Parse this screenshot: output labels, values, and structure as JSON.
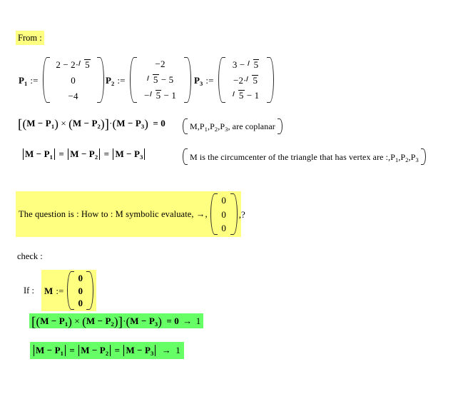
{
  "document": {
    "kind": "mathcad-worksheet",
    "colors": {
      "highlight_yellow": "#ffff80",
      "highlight_green": "#66ff66",
      "text": "#000000",
      "background": "#ffffff"
    }
  },
  "from_label": "From :",
  "definitions": [
    {
      "name": "P",
      "index": "1",
      "assign": ":=",
      "components": [
        "2 − 2·√5",
        "0",
        "−4"
      ],
      "components_parts": [
        {
          "pre": "2 − 2·",
          "radicand": "5",
          "post": ""
        },
        {
          "pre": "0",
          "radicand": "",
          "post": ""
        },
        {
          "pre": "−4",
          "radicand": "",
          "post": ""
        }
      ]
    },
    {
      "name": "P",
      "index": "2",
      "assign": ":=",
      "components": [
        "−2",
        "√5 − 5",
        "−√5 − 1"
      ],
      "components_parts": [
        {
          "pre": "−2",
          "radicand": "",
          "post": ""
        },
        {
          "pre": "",
          "radicand": "5",
          "post": " − 5"
        },
        {
          "pre": "−",
          "radicand": "5",
          "post": " − 1"
        }
      ]
    },
    {
      "name": "P",
      "index": "3",
      "assign": ":=",
      "components": [
        "3 − √5",
        "−2·√5",
        "√5 − 1"
      ],
      "components_parts": [
        {
          "pre": "3 − ",
          "radicand": "5",
          "post": ""
        },
        {
          "pre": "−2·",
          "radicand": "5",
          "post": ""
        },
        {
          "pre": "",
          "radicand": "5",
          "post": " − 1"
        }
      ]
    }
  ],
  "equations": {
    "coplanar": {
      "lhs_bracket_open": "[",
      "term1": {
        "open": "(",
        "text": "M − P",
        "sub": "1",
        "close": ")"
      },
      "cross": "×",
      "term2": {
        "open": "(",
        "text": "M − P",
        "sub": "2",
        "close": ")"
      },
      "lhs_bracket_close": "]",
      "dot": "·",
      "term3": {
        "open": "(",
        "text": "M − P",
        "sub": "3",
        "close": ")"
      },
      "equals": "=",
      "rhs": "0",
      "annotation": "M,P1,P2,P3, are coplanar",
      "annotation_parts": [
        "M,P",
        "1",
        ",P",
        "2",
        ",P",
        "3",
        ", are coplanar"
      ]
    },
    "equidistant": {
      "t1": {
        "text": "M − P",
        "sub": "1"
      },
      "eq1": "=",
      "t2": {
        "text": "M − P",
        "sub": "2"
      },
      "eq2": "=",
      "t3": {
        "text": "M − P",
        "sub": "3"
      },
      "annotation": "M is the circumcenter of the triangle that has vertex are :,P1,P2,P3",
      "annotation_prefix": "M is the circumcenter of the triangle that has vertex are :,P",
      "annotation_parts": [
        "M is the circumcenter of the triangle that has vertex are :,P",
        "1",
        ",P",
        "2",
        ",P",
        "3"
      ]
    }
  },
  "question": {
    "highlighted": true,
    "text": "The question is : How to : M symbolic evaluate, →,",
    "vector": [
      "0",
      "0",
      "0"
    ],
    "suffix": ",?"
  },
  "check": {
    "label": "check :",
    "if_label": "If :",
    "m_name": "M",
    "m_assign": ":=",
    "m_vector": [
      "0",
      "0",
      "0"
    ]
  },
  "results": [
    {
      "highlight": "green",
      "expression": "[(M − P1) × (M − P2)]·(M − P3) = 0 → 1",
      "equals": "=",
      "rhs": "0",
      "arrow": "→",
      "value": "1"
    },
    {
      "highlight": "green",
      "expression": "|M − P1| = |M − P2| = |M − P3| → 1",
      "arrow": "→",
      "value": "1"
    }
  ],
  "glyphs": {
    "sqrt": "√",
    "times": "×",
    "dot": "·",
    "arrow": "→",
    "minus": "−",
    "assign": ":=",
    "equals": "="
  }
}
